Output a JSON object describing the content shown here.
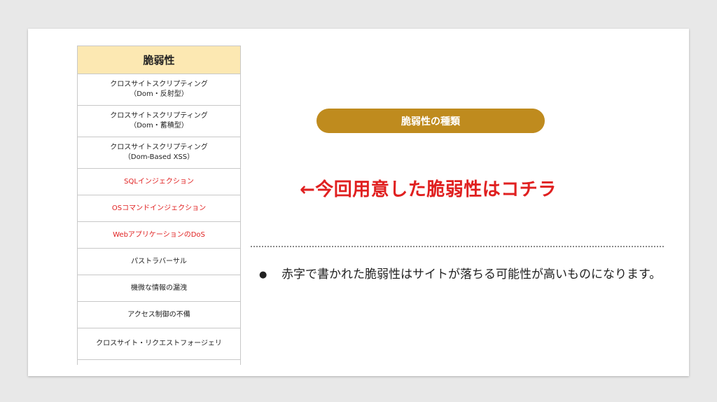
{
  "table": {
    "header": "脆弱性",
    "rows": [
      {
        "line1": "クロスサイトスクリプティング",
        "line2": "（Dom・反射型）"
      },
      {
        "line1": "クロスサイトスクリプティング",
        "line2": "（Dom・蓄積型）"
      },
      {
        "line1": "クロスサイトスクリプティング",
        "line2": "（Dom-Based XSS）"
      },
      {
        "line1": "SQLインジェクション"
      },
      {
        "line1": "OSコマンドインジェクション"
      },
      {
        "line1": "WebアプリケーションのDoS"
      },
      {
        "line1": "パストラバーサル"
      },
      {
        "line1": "機微な情報の漏洩"
      },
      {
        "line1": "アクセス制御の不備"
      },
      {
        "line1": "クロスサイト・リクエストフォージェリ"
      }
    ]
  },
  "pill_label": "脆弱性の種類",
  "headline": "←今回用意した脆弱性はコチラ",
  "bullet": {
    "dot": "●",
    "text": "赤字で書かれた脆弱性はサイトが落ちる可能性が高いものになります。"
  },
  "colors": {
    "header_bg": "#fce8b2",
    "pill_bg": "#bf8b1e",
    "accent_red": "#e02020"
  }
}
